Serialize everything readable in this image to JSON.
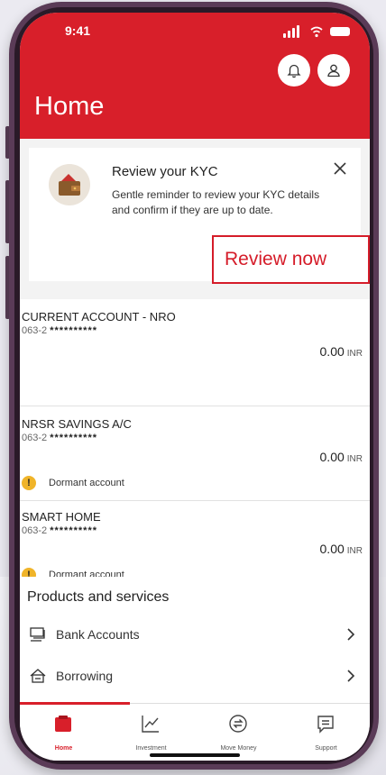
{
  "status_bar": {
    "time": "9:41"
  },
  "header": {
    "title": "Home",
    "notification_icon": "bell-icon",
    "profile_icon": "user-icon",
    "color": "#d81f2a"
  },
  "kyc_card": {
    "title": "Review your KYC",
    "body": "Gentle reminder to review your KYC details and confirm if they are up to date.",
    "action": "Review now"
  },
  "accounts": [
    {
      "name": "CURRENT ACCOUNT - NRO",
      "number_prefix": "063-2",
      "number_mask": "**********",
      "balance": "0.00",
      "currency": "INR",
      "status": ""
    },
    {
      "name": "NRSR SAVINGS A/C",
      "number_prefix": "063-2",
      "number_mask": "**********",
      "balance": "0.00",
      "currency": "INR",
      "status": "Dormant account"
    },
    {
      "name": "SMART HOME",
      "number_prefix": "063-2",
      "number_mask": "**********",
      "balance": "0.00",
      "currency": "INR",
      "status": "Dormant account"
    }
  ],
  "products": {
    "heading": "Products and services",
    "items": [
      {
        "label": "Bank Accounts",
        "icon": "bank-accounts-icon"
      },
      {
        "label": "Borrowing",
        "icon": "borrowing-icon"
      }
    ]
  },
  "tabs": [
    {
      "label": "Home",
      "icon": "home-icon",
      "active": true
    },
    {
      "label": "Investment",
      "icon": "investment-chart-icon",
      "active": false
    },
    {
      "label": "Move Money",
      "icon": "move-money-icon",
      "active": false
    },
    {
      "label": "Support",
      "icon": "support-chat-icon",
      "active": false
    }
  ]
}
